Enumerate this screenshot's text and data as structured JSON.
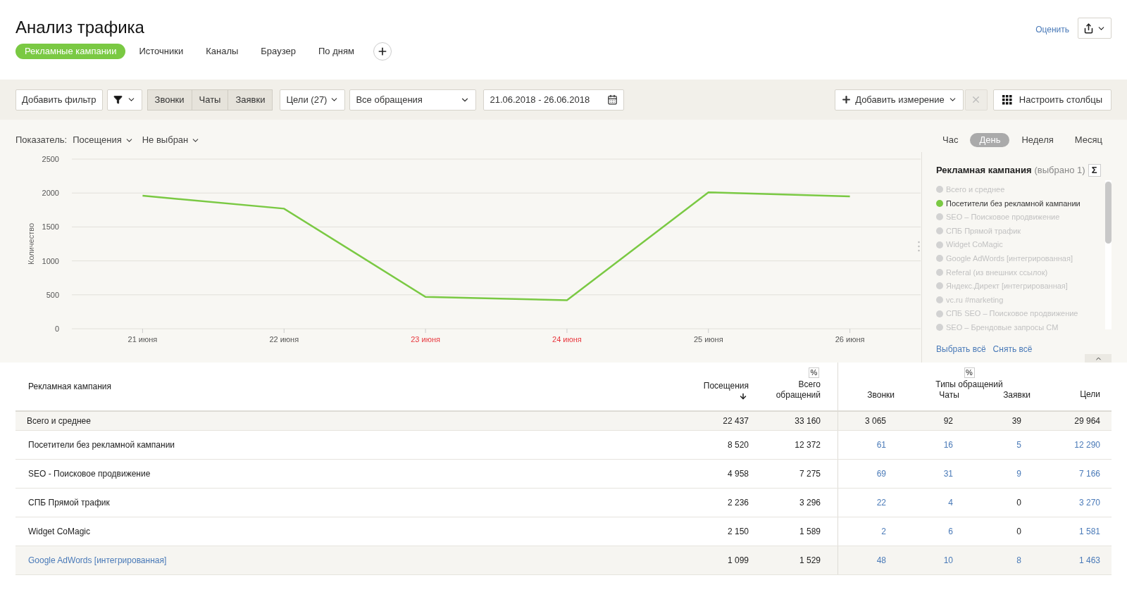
{
  "page": {
    "title": "Анализ трафика",
    "rate_link": "Оценить"
  },
  "report_tabs": [
    {
      "label": "Рекламные кампании",
      "selected": true
    },
    {
      "label": "Источники",
      "selected": false
    },
    {
      "label": "Каналы",
      "selected": false
    },
    {
      "label": "Браузер",
      "selected": false
    },
    {
      "label": "По дням",
      "selected": false
    }
  ],
  "toolbar": {
    "add_filter": "Добавить фильтр",
    "request_types": [
      {
        "label": "Звонки",
        "selected": true
      },
      {
        "label": "Чаты",
        "selected": true
      },
      {
        "label": "Заявки",
        "selected": true
      }
    ],
    "goals": "Цели (27)",
    "requests_select": "Все обращения",
    "date_range": "21.06.2018 - 26.06.2018",
    "add_dimension": "Добавить измерение",
    "remove_disabled": true,
    "configure_columns": "Настроить столбцы"
  },
  "chart_panel": {
    "metric_label": "Показатель:",
    "metric": "Посещения",
    "second_metric": "Не выбран",
    "periods": [
      {
        "label": "Час",
        "selected": false
      },
      {
        "label": "День",
        "selected": true
      },
      {
        "label": "Неделя",
        "selected": false
      },
      {
        "label": "Месяц",
        "selected": false
      }
    ],
    "weekend_flags": [
      false,
      false,
      true,
      true,
      false,
      false
    ],
    "chart_data": {
      "type": "line",
      "ylabel": "Количество",
      "categories": [
        "21 июня",
        "22 июня",
        "23 июня",
        "24 июня",
        "25 июня",
        "26 июня"
      ],
      "series": [
        {
          "color": "#7ac943",
          "values": [
            1960,
            1770,
            470,
            420,
            2010,
            1950
          ]
        }
      ],
      "grid": true,
      "ylim": [
        0,
        2500
      ],
      "yticks": [
        0,
        500,
        1000,
        1500,
        2000,
        2500
      ]
    }
  },
  "legend": {
    "title": "Рекламная кампания",
    "count": "(выбрано 1)",
    "sum_button": "Σ",
    "items": [
      {
        "label": "Всего и среднее",
        "selected": false
      },
      {
        "label": "Посетители без рекламной кампании",
        "selected": true
      },
      {
        "label": "SEO – Поисковое продвижение",
        "selected": false
      },
      {
        "label": "СПБ Прямой трафик",
        "selected": false
      },
      {
        "label": "Widget CoMagic",
        "selected": false
      },
      {
        "label": "Google AdWords [интегрированная]",
        "selected": false
      },
      {
        "label": "Referal (из внешних ссылок)",
        "selected": false
      },
      {
        "label": "Яндекс.Директ [интегрированная]",
        "selected": false
      },
      {
        "label": "vc.ru #marketing",
        "selected": false
      },
      {
        "label": "СПБ SEO – Поисковое продвижение",
        "selected": false
      },
      {
        "label": "SEO – Брендовые запросы CM",
        "selected": false
      }
    ],
    "select_all": "Выбрать всё",
    "clear_all": "Снять всё"
  },
  "table": {
    "header": {
      "name_column": "Рекламная кампания",
      "visits": {
        "label": "Посещения",
        "sorted": true
      },
      "total_requests": {
        "label": "Всего обращений",
        "percent_toggle": "%"
      },
      "request_types": {
        "label": "Типы обращений",
        "percent_toggle": "%",
        "columns": [
          "Звонки",
          "Чаты",
          "Заявки"
        ]
      },
      "goals": {
        "label": "Цели"
      }
    },
    "rows": [
      {
        "kind": "total",
        "highlighted": false,
        "name": "Всего и среднее",
        "values": [
          "22 437",
          "33 160",
          "3 065",
          "92",
          "39",
          "29 964"
        ],
        "linked": [
          false,
          false,
          false,
          false,
          false,
          false
        ]
      },
      {
        "kind": "campaign",
        "highlighted": false,
        "name": "Посетители без рекламной кампании",
        "values": [
          "8 520",
          "12 372",
          "61",
          "16",
          "5",
          "12 290"
        ],
        "linked": [
          false,
          false,
          true,
          true,
          true,
          true
        ]
      },
      {
        "kind": "campaign",
        "highlighted": false,
        "name": "SEO - Поисковое продвижение",
        "values": [
          "4 958",
          "7 275",
          "69",
          "31",
          "9",
          "7 166"
        ],
        "linked": [
          false,
          false,
          true,
          true,
          true,
          true
        ]
      },
      {
        "kind": "campaign",
        "highlighted": false,
        "name": "СПБ Прямой трафик",
        "values": [
          "2 236",
          "3 296",
          "22",
          "4",
          "0",
          "3 270"
        ],
        "linked": [
          false,
          false,
          true,
          true,
          false,
          true
        ]
      },
      {
        "kind": "campaign",
        "highlighted": false,
        "name": "Widget CoMagic",
        "values": [
          "2 150",
          "1 589",
          "2",
          "6",
          "0",
          "1 581"
        ],
        "linked": [
          false,
          false,
          true,
          true,
          false,
          true
        ]
      },
      {
        "kind": "campaign",
        "highlighted": true,
        "name": "Google AdWords [интегрированная]",
        "values": [
          "1 099",
          "1 529",
          "48",
          "10",
          "8",
          "1 463"
        ],
        "linked": [
          false,
          false,
          true,
          true,
          true,
          true
        ]
      }
    ]
  }
}
